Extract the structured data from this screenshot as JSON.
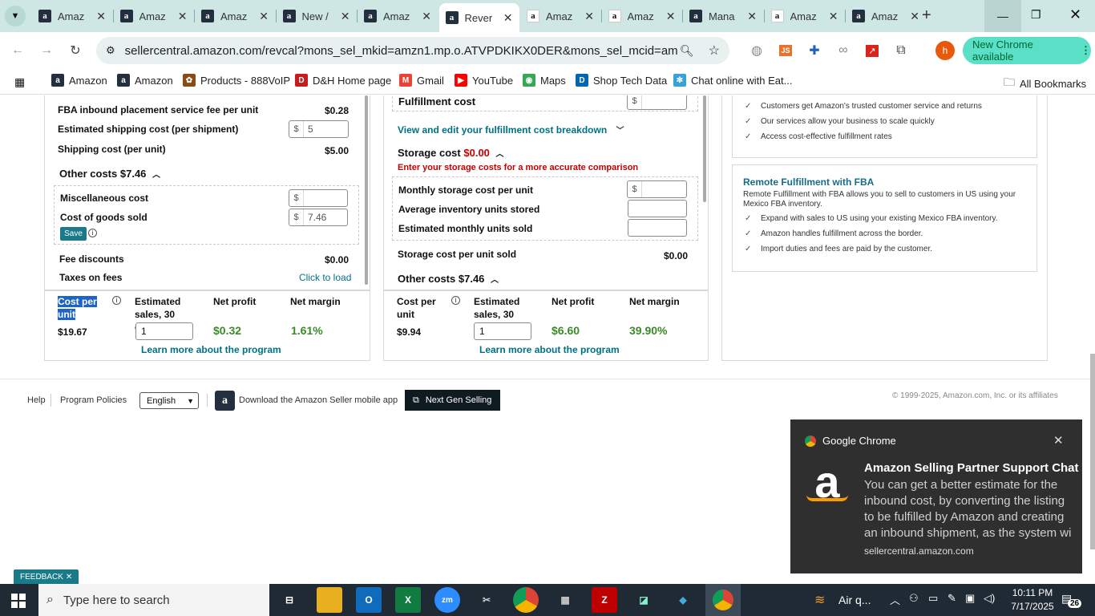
{
  "browser": {
    "tabs": [
      {
        "label": "Amaz",
        "icon": "amazon-a-icon",
        "active": false
      },
      {
        "label": "Amaz",
        "icon": "amazon-a-icon",
        "active": false
      },
      {
        "label": "Amaz",
        "icon": "amazon-a-icon",
        "active": false
      },
      {
        "label": "New /",
        "icon": "amazon-a-icon",
        "active": false
      },
      {
        "label": "Amaz",
        "icon": "amazon-a-icon",
        "active": false
      },
      {
        "label": "Rever",
        "icon": "amazon-a-icon",
        "active": true
      },
      {
        "label": "Amaz",
        "icon": "amazon-smile-icon",
        "active": false
      },
      {
        "label": "Amaz",
        "icon": "amazon-smile-icon",
        "active": false
      },
      {
        "label": "Mana",
        "icon": "amazon-a-icon",
        "active": false
      },
      {
        "label": "Amaz",
        "icon": "amazon-smile-icon",
        "active": false
      },
      {
        "label": "Amaz",
        "icon": "amazon-a-icon",
        "active": false
      }
    ],
    "url": "sellercentral.amazon.com/revcal?mons_sel_mkid=amzn1.mp.o.ATVPDKIKX0DER&mons_sel_mcid=amzn1.mer...",
    "new_chrome_label": "New Chrome available",
    "profile_initial": "h",
    "bookmarks": [
      {
        "label": "Amazon",
        "icon": "amazon-icon"
      },
      {
        "label": "Amazon",
        "icon": "amazon-icon"
      },
      {
        "label": "Products - 888VoIP",
        "icon": "voip-icon"
      },
      {
        "label": "D&H Home page",
        "icon": "dh-icon"
      },
      {
        "label": "Gmail",
        "icon": "gmail-icon"
      },
      {
        "label": "YouTube",
        "icon": "youtube-icon"
      },
      {
        "label": "Maps",
        "icon": "maps-icon"
      },
      {
        "label": "Shop Tech Data",
        "icon": "techdata-icon"
      },
      {
        "label": "Chat online with Eat...",
        "icon": "chat-icon"
      }
    ],
    "all_bookmarks_label": "All Bookmarks"
  },
  "left_panel": {
    "fba_inbound_label": "FBA inbound placement service fee per unit",
    "fba_inbound_value": "$0.28",
    "est_shipping_label": "Estimated shipping cost (per shipment)",
    "est_shipping_currency": "$",
    "est_shipping_value": "5",
    "shipping_unit_label": "Shipping cost (per unit)",
    "shipping_unit_value": "$5.00",
    "other_costs_label": "Other costs",
    "other_costs_value": "$7.46",
    "misc_label": "Miscellaneous cost",
    "misc_currency": "$",
    "misc_value": "",
    "cogs_label": "Cost of goods sold",
    "cogs_currency": "$",
    "cogs_value": "7.46",
    "save_label": "Save",
    "fee_discounts_label": "Fee discounts",
    "fee_discounts_value": "$0.00",
    "taxes_label": "Taxes on fees",
    "taxes_link": "Click to load"
  },
  "left_summary": {
    "cost_per_unit_label": "Cost per unit",
    "cost_per_unit_value": "$19.67",
    "est_sales_label": "Estimated sales, 30 days",
    "est_sales_value": "1",
    "net_profit_label": "Net profit",
    "net_profit_value": "$0.32",
    "net_margin_label": "Net margin",
    "net_margin_value": "1.61%",
    "learn_more": "Learn more about the program"
  },
  "middle_panel": {
    "fulfillment_cost_label": "Fulfillment cost",
    "fulfillment_currency": "$",
    "view_edit_link": "View and edit your fulfillment cost breakdown",
    "storage_cost_label": "Storage cost",
    "storage_cost_value": "$0.00",
    "storage_warning": "Enter your storage costs for a more accurate comparison",
    "monthly_storage_label": "Monthly storage cost per unit",
    "monthly_storage_currency": "$",
    "avg_inventory_label": "Average inventory units stored",
    "est_monthly_units_label": "Estimated monthly units sold",
    "storage_per_unit_label": "Storage cost per unit sold",
    "storage_per_unit_value": "$0.00",
    "other_costs_label": "Other costs",
    "other_costs_value": "$7.46"
  },
  "middle_summary": {
    "cost_per_unit_label": "Cost per unit",
    "cost_per_unit_value": "$9.94",
    "est_sales_label": "Estimated sales, 30 days",
    "est_sales_value": "1",
    "net_profit_label": "Net profit",
    "net_profit_value": "$6.60",
    "net_margin_label": "Net margin",
    "net_margin_value": "39.90%",
    "learn_more": "Learn more about the program"
  },
  "right_panel": {
    "checks_top": [
      "Customers get Amazon's trusted customer service and returns",
      "Our services allow your business to scale quickly",
      "Access cost-effective fulfillment rates"
    ],
    "remote_title": "Remote Fulfillment with FBA",
    "remote_desc": "Remote Fulfillment with FBA allows you to sell to customers in US using your Mexico FBA inventory.",
    "checks_remote": [
      "Expand with sales to US using your existing Mexico FBA inventory.",
      "Amazon handles fulfillment across the border.",
      "Import duties and fees are paid by the customer."
    ]
  },
  "footer": {
    "help": "Help",
    "program_policies": "Program Policies",
    "language": "English",
    "download_app": "Download the Amazon Seller mobile app",
    "next_gen": "Next Gen Selling",
    "copyright": "© 1999-2025, Amazon.com, Inc. or its affiliates",
    "feedback": "FEEDBACK"
  },
  "notification": {
    "app": "Google Chrome",
    "title": "Amazon Selling Partner Support Chat",
    "body": "You can get a better estimate for the inbound cost, by converting the listing to be fulfilled by Amazon and creating an inbound shipment, as the system wi",
    "source": "sellercentral.amazon.com"
  },
  "taskbar": {
    "search_placeholder": "Type here to search",
    "weather": "Air q...",
    "time": "10:11 PM",
    "date": "7/17/2025",
    "notif_count": "26"
  }
}
